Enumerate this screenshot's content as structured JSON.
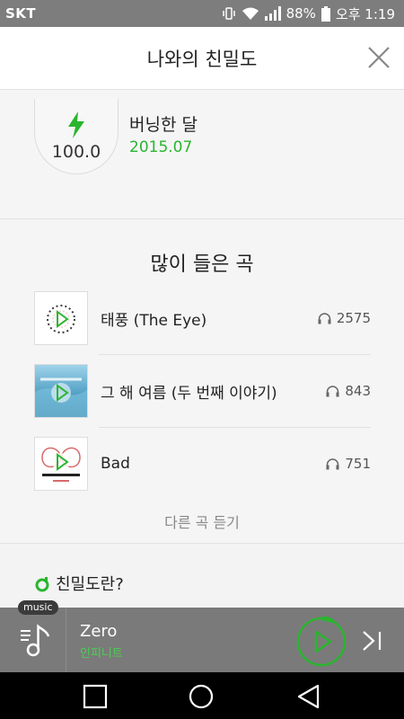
{
  "status_bar": {
    "carrier": "SKT",
    "battery": "88%",
    "time": "오후 1:19"
  },
  "header": {
    "title": "나와의 친밀도"
  },
  "score": {
    "value": "100.0",
    "label": "버닝한 달",
    "date": "2015.07"
  },
  "most_played": {
    "title": "많이 들은 곡",
    "tracks": [
      {
        "title": "태풍 (The Eye)",
        "plays": "2575"
      },
      {
        "title": "그 해 여름 (두 번째 이야기)",
        "plays": "843"
      },
      {
        "title": "Bad",
        "plays": "751"
      }
    ],
    "more_label": "다른 곡 듣기"
  },
  "intimacy": {
    "label": "친밀도란?"
  },
  "player": {
    "badge": "music",
    "song": "Zero",
    "artist": "인피니트",
    "progress": 0.08
  },
  "colors": {
    "accent_green": "#2ab52f",
    "statusbar": "#7d7d7d",
    "player_bg": "#7a7a7a"
  }
}
